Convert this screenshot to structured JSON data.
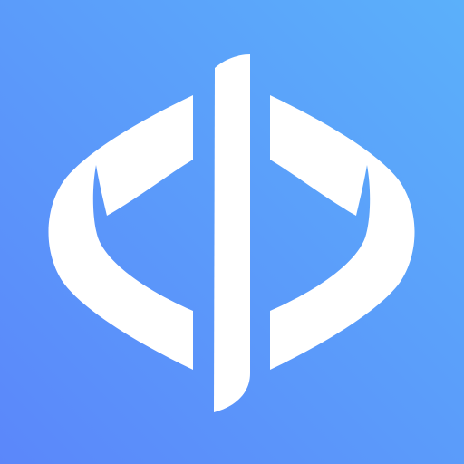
{
  "icon": {
    "name": "code-brackets-logo",
    "shape": "rounded-square",
    "colors": {
      "gradient_start": "#5B87FA",
      "gradient_end": "#5BB0FA",
      "glyph": "#FFFFFF"
    }
  }
}
